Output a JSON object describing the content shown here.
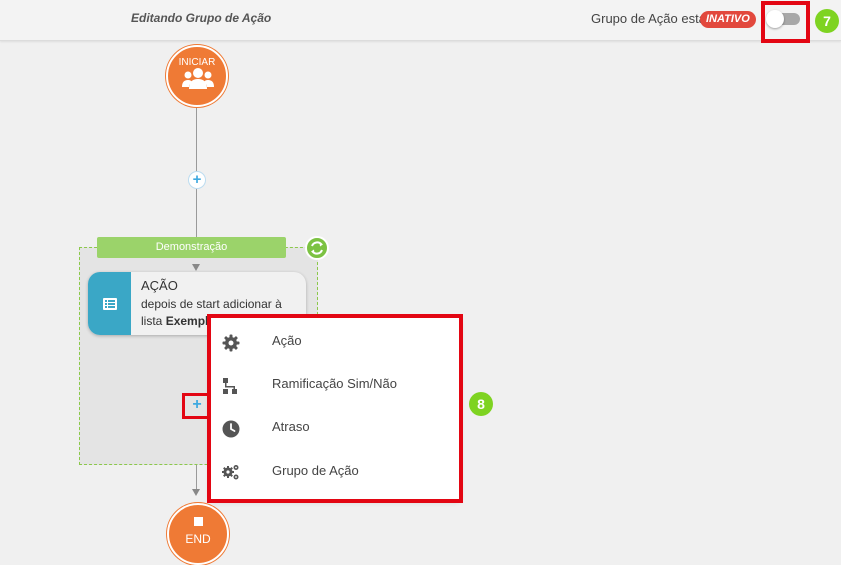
{
  "header": {
    "title": "Editando Grupo de Ação",
    "status_label": "Grupo de Ação está",
    "status_badge": "INATIVO"
  },
  "annotations": {
    "step_7": "7",
    "step_8": "8"
  },
  "flow": {
    "start_label": "INICIAR",
    "group_name": "Demonstração",
    "action_card": {
      "title": "AÇÃO",
      "desc_line1": "depois de start adicionar à",
      "desc_prefix": "lista ",
      "desc_bold": "Exempl"
    },
    "end_label": "END"
  },
  "menu": {
    "items": [
      {
        "label": "Ação",
        "icon": "gear-icon"
      },
      {
        "label": "Ramificação Sim/Não",
        "icon": "branch-icon"
      },
      {
        "label": "Atraso",
        "icon": "clock-icon"
      },
      {
        "label": "Grupo de Ação",
        "icon": "gears-icon"
      }
    ]
  },
  "colors": {
    "node_orange": "#ef7a35",
    "inactive_badge": "#e2483d",
    "highlight_red": "#e30613",
    "step_green": "#7ed321",
    "group_tag_green": "#9bd36a",
    "action_teal": "#3aa7c6",
    "plus_blue": "#3fa9e0"
  }
}
